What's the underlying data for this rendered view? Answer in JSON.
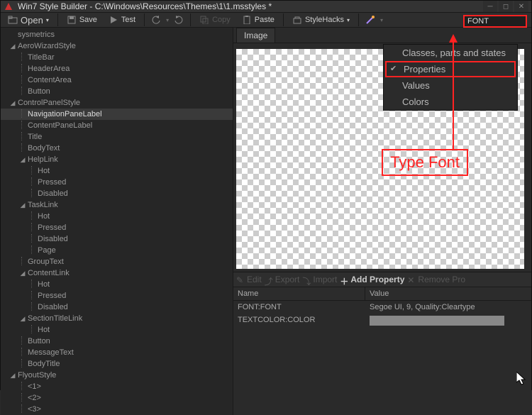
{
  "titlebar": {
    "title": "Win7 Style Builder - C:\\Windows\\Resources\\Themes\\1\\1.msstyles *"
  },
  "toolbar": {
    "open": "Open",
    "save": "Save",
    "test": "Test",
    "copy": "Copy",
    "paste": "Paste",
    "stylehacks": "StyleHacks",
    "search_value": "FONT"
  },
  "tree": {
    "items": [
      {
        "label": "sysmetrics",
        "level": 1,
        "arrow": "none"
      },
      {
        "label": "AeroWizardStyle",
        "level": 1,
        "arrow": "down"
      },
      {
        "label": "TitleBar",
        "level": 2,
        "arrow": "leaf"
      },
      {
        "label": "HeaderArea",
        "level": 2,
        "arrow": "leaf"
      },
      {
        "label": "ContentArea",
        "level": 2,
        "arrow": "leaf"
      },
      {
        "label": "Button",
        "level": 2,
        "arrow": "leaf"
      },
      {
        "label": "ControlPanelStyle",
        "level": 1,
        "arrow": "down"
      },
      {
        "label": "NavigationPaneLabel",
        "level": 2,
        "arrow": "leaf",
        "selected": true
      },
      {
        "label": "ContentPaneLabel",
        "level": 2,
        "arrow": "leaf"
      },
      {
        "label": "Title",
        "level": 2,
        "arrow": "leaf"
      },
      {
        "label": "BodyText",
        "level": 2,
        "arrow": "leaf"
      },
      {
        "label": "HelpLink",
        "level": 2,
        "arrow": "down"
      },
      {
        "label": "Hot",
        "level": 3,
        "arrow": "leaf"
      },
      {
        "label": "Pressed",
        "level": 3,
        "arrow": "leaf"
      },
      {
        "label": "Disabled",
        "level": 3,
        "arrow": "leaf"
      },
      {
        "label": "TaskLink",
        "level": 2,
        "arrow": "down"
      },
      {
        "label": "Hot",
        "level": 3,
        "arrow": "leaf"
      },
      {
        "label": "Pressed",
        "level": 3,
        "arrow": "leaf"
      },
      {
        "label": "Disabled",
        "level": 3,
        "arrow": "leaf"
      },
      {
        "label": "Page",
        "level": 3,
        "arrow": "leaf"
      },
      {
        "label": "GroupText",
        "level": 2,
        "arrow": "leaf"
      },
      {
        "label": "ContentLink",
        "level": 2,
        "arrow": "down"
      },
      {
        "label": "Hot",
        "level": 3,
        "arrow": "leaf"
      },
      {
        "label": "Pressed",
        "level": 3,
        "arrow": "leaf"
      },
      {
        "label": "Disabled",
        "level": 3,
        "arrow": "leaf"
      },
      {
        "label": "SectionTitleLink",
        "level": 2,
        "arrow": "down"
      },
      {
        "label": "Hot",
        "level": 3,
        "arrow": "leaf"
      },
      {
        "label": "Button",
        "level": 2,
        "arrow": "leaf"
      },
      {
        "label": "MessageText",
        "level": 2,
        "arrow": "leaf"
      },
      {
        "label": "BodyTitle",
        "level": 2,
        "arrow": "leaf"
      },
      {
        "label": "FlyoutStyle",
        "level": 1,
        "arrow": "down"
      },
      {
        "label": "<1>",
        "level": 2,
        "arrow": "leaf"
      },
      {
        "label": "<2>",
        "level": 2,
        "arrow": "leaf"
      },
      {
        "label": "<3>",
        "level": 2,
        "arrow": "leaf"
      }
    ]
  },
  "dropdown": {
    "items": [
      {
        "label": "Classes, parts and states",
        "checked": false,
        "highlight": false
      },
      {
        "label": "Properties",
        "checked": true,
        "highlight": true
      },
      {
        "label": "Values",
        "checked": false,
        "highlight": false
      },
      {
        "label": "Colors",
        "checked": false,
        "highlight": false
      }
    ]
  },
  "image_tab": "Image",
  "annotation": {
    "label": "Type Font"
  },
  "prop_toolbar": {
    "edit": "Edit",
    "export": "Export",
    "import": "Import",
    "add": "Add Property",
    "remove": "Remove Pro"
  },
  "prop_table": {
    "head_name": "Name",
    "head_value": "Value",
    "rows": [
      {
        "name": "FONT:FONT",
        "value": "Segoe UI, 9, Quality:Cleartype"
      },
      {
        "name": "TEXTCOLOR:COLOR",
        "value": ""
      }
    ]
  }
}
